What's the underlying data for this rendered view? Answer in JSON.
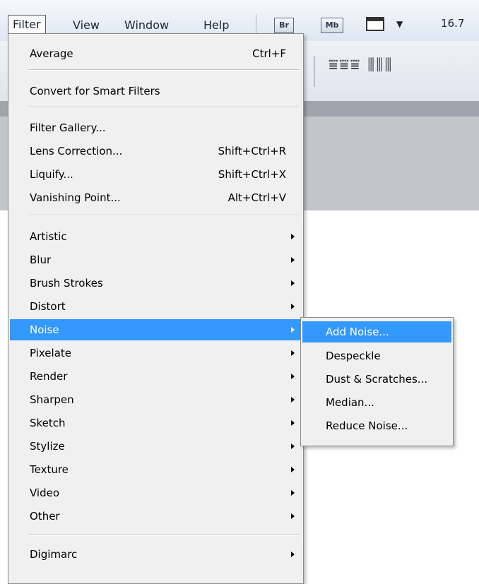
{
  "menubar": {
    "items": [
      "Filter",
      "View",
      "Window",
      "Help"
    ],
    "apps": [
      "Br",
      "Mb"
    ],
    "zoom": "16.7"
  },
  "filter_menu": {
    "items": [
      {
        "label": "Average",
        "shortcut": "Ctrl+F"
      },
      {
        "label": "Convert for Smart Filters"
      },
      {
        "label": "Filter Gallery..."
      },
      {
        "label": "Lens Correction...",
        "shortcut": "Shift+Ctrl+R"
      },
      {
        "label": "Liquify...",
        "shortcut": "Shift+Ctrl+X"
      },
      {
        "label": "Vanishing Point...",
        "shortcut": "Alt+Ctrl+V"
      },
      {
        "label": "Artistic",
        "submenu": true
      },
      {
        "label": "Blur",
        "submenu": true
      },
      {
        "label": "Brush Strokes",
        "submenu": true
      },
      {
        "label": "Distort",
        "submenu": true
      },
      {
        "label": "Noise",
        "submenu": true,
        "highlighted": true
      },
      {
        "label": "Pixelate",
        "submenu": true
      },
      {
        "label": "Render",
        "submenu": true
      },
      {
        "label": "Sharpen",
        "submenu": true
      },
      {
        "label": "Sketch",
        "submenu": true
      },
      {
        "label": "Stylize",
        "submenu": true
      },
      {
        "label": "Texture",
        "submenu": true
      },
      {
        "label": "Video",
        "submenu": true
      },
      {
        "label": "Other",
        "submenu": true
      },
      {
        "label": "Digimarc",
        "submenu": true
      }
    ]
  },
  "noise_submenu": {
    "items": [
      {
        "label": "Add Noise...",
        "highlighted": true
      },
      {
        "label": "Despeckle"
      },
      {
        "label": "Dust & Scratches..."
      },
      {
        "label": "Median..."
      },
      {
        "label": "Reduce Noise..."
      }
    ]
  },
  "colors": {
    "highlight": "#3399ff",
    "menu_bg": "#f0f0f0"
  }
}
